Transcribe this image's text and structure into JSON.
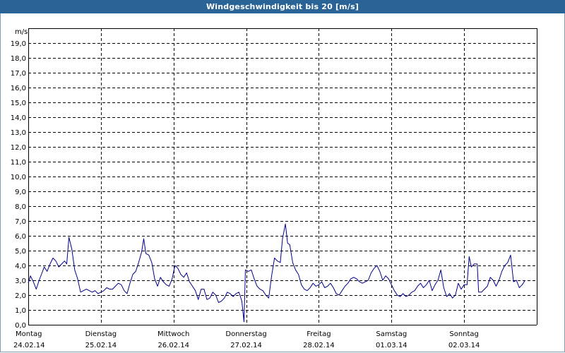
{
  "window": {
    "title": "Windgeschwindigkeit bis 20 [m/s]"
  },
  "colors": {
    "titlebar": "#2a6396",
    "series": "#00008b",
    "grid": "#000000"
  },
  "chart_data": {
    "type": "line",
    "title": "Windgeschwindigkeit bis 20 [m/s]",
    "ylabel": "m/s",
    "ylim": [
      0,
      20
    ],
    "ytick_step": 1,
    "yticks": [
      "0,0",
      "1,0",
      "2,0",
      "3,0",
      "4,0",
      "5,0",
      "6,0",
      "7,0",
      "8,0",
      "9,0",
      "10,0",
      "11,0",
      "12,0",
      "13,0",
      "14,0",
      "15,0",
      "16,0",
      "17,0",
      "18,0",
      "19,0"
    ],
    "xlim": [
      0,
      7
    ],
    "days": [
      {
        "name": "Montag",
        "date": "24.02.14"
      },
      {
        "name": "Dienstag",
        "date": "25.02.14"
      },
      {
        "name": "Mittwoch",
        "date": "26.02.14"
      },
      {
        "name": "Donnerstag",
        "date": "27.02.14"
      },
      {
        "name": "Freitag",
        "date": "28.02.14"
      },
      {
        "name": "Samstag",
        "date": "01.03.14"
      },
      {
        "name": "Sonntag",
        "date": "02.03.14"
      }
    ],
    "grid": true,
    "series": [
      {
        "color": "#00008b",
        "points": [
          [
            0.0,
            2.8
          ],
          [
            0.03,
            3.3
          ],
          [
            0.07,
            2.9
          ],
          [
            0.11,
            2.4
          ],
          [
            0.15,
            3.0
          ],
          [
            0.19,
            3.5
          ],
          [
            0.22,
            3.9
          ],
          [
            0.26,
            3.6
          ],
          [
            0.3,
            4.1
          ],
          [
            0.34,
            4.5
          ],
          [
            0.38,
            4.3
          ],
          [
            0.42,
            3.9
          ],
          [
            0.46,
            4.1
          ],
          [
            0.5,
            4.3
          ],
          [
            0.53,
            4.1
          ],
          [
            0.56,
            5.9
          ],
          [
            0.6,
            5.1
          ],
          [
            0.64,
            3.7
          ],
          [
            0.68,
            3.1
          ],
          [
            0.72,
            2.2
          ],
          [
            0.76,
            2.3
          ],
          [
            0.8,
            2.4
          ],
          [
            0.84,
            2.3
          ],
          [
            0.88,
            2.2
          ],
          [
            0.92,
            2.3
          ],
          [
            0.96,
            2.1
          ],
          [
            1.0,
            2.2
          ],
          [
            1.04,
            2.3
          ],
          [
            1.08,
            2.5
          ],
          [
            1.12,
            2.4
          ],
          [
            1.16,
            2.4
          ],
          [
            1.2,
            2.6
          ],
          [
            1.24,
            2.8
          ],
          [
            1.28,
            2.7
          ],
          [
            1.32,
            2.3
          ],
          [
            1.36,
            2.1
          ],
          [
            1.4,
            2.8
          ],
          [
            1.44,
            3.4
          ],
          [
            1.48,
            3.6
          ],
          [
            1.52,
            4.2
          ],
          [
            1.56,
            4.9
          ],
          [
            1.59,
            5.8
          ],
          [
            1.62,
            4.8
          ],
          [
            1.66,
            4.7
          ],
          [
            1.7,
            4.2
          ],
          [
            1.74,
            3.1
          ],
          [
            1.78,
            2.6
          ],
          [
            1.82,
            3.2
          ],
          [
            1.86,
            2.9
          ],
          [
            1.9,
            2.7
          ],
          [
            1.94,
            2.6
          ],
          [
            1.98,
            3.1
          ],
          [
            2.02,
            4.0
          ],
          [
            2.06,
            3.8
          ],
          [
            2.1,
            3.4
          ],
          [
            2.14,
            3.2
          ],
          [
            2.18,
            3.5
          ],
          [
            2.22,
            2.9
          ],
          [
            2.26,
            2.6
          ],
          [
            2.3,
            2.3
          ],
          [
            2.34,
            1.7
          ],
          [
            2.38,
            2.4
          ],
          [
            2.42,
            2.4
          ],
          [
            2.46,
            1.7
          ],
          [
            2.5,
            1.8
          ],
          [
            2.54,
            2.2
          ],
          [
            2.58,
            2.0
          ],
          [
            2.62,
            1.5
          ],
          [
            2.66,
            1.6
          ],
          [
            2.7,
            1.8
          ],
          [
            2.74,
            2.2
          ],
          [
            2.78,
            2.1
          ],
          [
            2.82,
            1.9
          ],
          [
            2.86,
            2.1
          ],
          [
            2.9,
            2.2
          ],
          [
            2.94,
            1.6
          ],
          [
            2.97,
            0.2
          ],
          [
            2.99,
            3.7
          ],
          [
            3.03,
            3.6
          ],
          [
            3.07,
            3.7
          ],
          [
            3.11,
            3.1
          ],
          [
            3.15,
            2.6
          ],
          [
            3.19,
            2.4
          ],
          [
            3.23,
            2.3
          ],
          [
            3.27,
            2.0
          ],
          [
            3.31,
            1.8
          ],
          [
            3.35,
            3.3
          ],
          [
            3.39,
            4.5
          ],
          [
            3.43,
            4.3
          ],
          [
            3.47,
            4.2
          ],
          [
            3.5,
            5.8
          ],
          [
            3.54,
            6.8
          ],
          [
            3.57,
            5.5
          ],
          [
            3.6,
            5.4
          ],
          [
            3.64,
            4.2
          ],
          [
            3.68,
            3.7
          ],
          [
            3.72,
            3.4
          ],
          [
            3.76,
            2.7
          ],
          [
            3.8,
            2.4
          ],
          [
            3.84,
            2.3
          ],
          [
            3.88,
            2.5
          ],
          [
            3.92,
            2.8
          ],
          [
            3.96,
            2.6
          ],
          [
            4.0,
            2.7
          ],
          [
            4.04,
            2.9
          ],
          [
            4.08,
            2.5
          ],
          [
            4.12,
            2.6
          ],
          [
            4.16,
            2.8
          ],
          [
            4.2,
            2.5
          ],
          [
            4.24,
            2.1
          ],
          [
            4.28,
            2.0
          ],
          [
            4.32,
            2.3
          ],
          [
            4.36,
            2.6
          ],
          [
            4.4,
            2.8
          ],
          [
            4.44,
            3.1
          ],
          [
            4.48,
            3.2
          ],
          [
            4.52,
            3.1
          ],
          [
            4.56,
            2.9
          ],
          [
            4.6,
            2.8
          ],
          [
            4.64,
            2.9
          ],
          [
            4.68,
            3.0
          ],
          [
            4.72,
            3.5
          ],
          [
            4.76,
            3.8
          ],
          [
            4.8,
            4.0
          ],
          [
            4.84,
            3.6
          ],
          [
            4.88,
            3.0
          ],
          [
            4.92,
            3.3
          ],
          [
            4.96,
            3.1
          ],
          [
            5.0,
            2.7
          ],
          [
            5.04,
            2.3
          ],
          [
            5.08,
            2.0
          ],
          [
            5.12,
            1.9
          ],
          [
            5.16,
            2.1
          ],
          [
            5.2,
            1.9
          ],
          [
            5.24,
            2.0
          ],
          [
            5.28,
            2.2
          ],
          [
            5.32,
            2.3
          ],
          [
            5.36,
            2.6
          ],
          [
            5.4,
            2.8
          ],
          [
            5.44,
            2.5
          ],
          [
            5.48,
            2.7
          ],
          [
            5.52,
            3.0
          ],
          [
            5.56,
            2.3
          ],
          [
            5.6,
            2.7
          ],
          [
            5.64,
            3.0
          ],
          [
            5.68,
            3.7
          ],
          [
            5.72,
            2.5
          ],
          [
            5.76,
            1.9
          ],
          [
            5.8,
            2.1
          ],
          [
            5.84,
            1.8
          ],
          [
            5.88,
            2.0
          ],
          [
            5.92,
            2.8
          ],
          [
            5.96,
            2.4
          ],
          [
            6.0,
            2.7
          ],
          [
            6.04,
            2.7
          ],
          [
            6.07,
            4.6
          ],
          [
            6.1,
            3.9
          ],
          [
            6.14,
            4.1
          ],
          [
            6.18,
            4.1
          ],
          [
            6.2,
            2.2
          ],
          [
            6.24,
            2.2
          ],
          [
            6.28,
            2.4
          ],
          [
            6.32,
            2.6
          ],
          [
            6.36,
            3.2
          ],
          [
            6.4,
            3.0
          ],
          [
            6.44,
            2.6
          ],
          [
            6.48,
            3.0
          ],
          [
            6.52,
            3.6
          ],
          [
            6.56,
            4.0
          ],
          [
            6.6,
            4.2
          ],
          [
            6.64,
            4.7
          ],
          [
            6.68,
            2.9
          ],
          [
            6.72,
            3.0
          ],
          [
            6.76,
            2.5
          ],
          [
            6.8,
            2.7
          ],
          [
            6.84,
            3.0
          ]
        ]
      }
    ]
  }
}
